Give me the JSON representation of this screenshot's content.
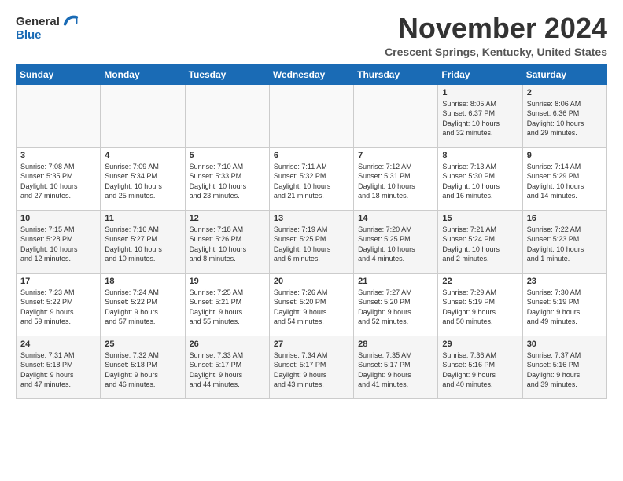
{
  "header": {
    "logo_line1": "General",
    "logo_line2": "Blue",
    "month": "November 2024",
    "location": "Crescent Springs, Kentucky, United States"
  },
  "days_of_week": [
    "Sunday",
    "Monday",
    "Tuesday",
    "Wednesday",
    "Thursday",
    "Friday",
    "Saturday"
  ],
  "weeks": [
    [
      {
        "day": "",
        "info": ""
      },
      {
        "day": "",
        "info": ""
      },
      {
        "day": "",
        "info": ""
      },
      {
        "day": "",
        "info": ""
      },
      {
        "day": "",
        "info": ""
      },
      {
        "day": "1",
        "info": "Sunrise: 8:05 AM\nSunset: 6:37 PM\nDaylight: 10 hours\nand 32 minutes."
      },
      {
        "day": "2",
        "info": "Sunrise: 8:06 AM\nSunset: 6:36 PM\nDaylight: 10 hours\nand 29 minutes."
      }
    ],
    [
      {
        "day": "3",
        "info": "Sunrise: 7:08 AM\nSunset: 5:35 PM\nDaylight: 10 hours\nand 27 minutes."
      },
      {
        "day": "4",
        "info": "Sunrise: 7:09 AM\nSunset: 5:34 PM\nDaylight: 10 hours\nand 25 minutes."
      },
      {
        "day": "5",
        "info": "Sunrise: 7:10 AM\nSunset: 5:33 PM\nDaylight: 10 hours\nand 23 minutes."
      },
      {
        "day": "6",
        "info": "Sunrise: 7:11 AM\nSunset: 5:32 PM\nDaylight: 10 hours\nand 21 minutes."
      },
      {
        "day": "7",
        "info": "Sunrise: 7:12 AM\nSunset: 5:31 PM\nDaylight: 10 hours\nand 18 minutes."
      },
      {
        "day": "8",
        "info": "Sunrise: 7:13 AM\nSunset: 5:30 PM\nDaylight: 10 hours\nand 16 minutes."
      },
      {
        "day": "9",
        "info": "Sunrise: 7:14 AM\nSunset: 5:29 PM\nDaylight: 10 hours\nand 14 minutes."
      }
    ],
    [
      {
        "day": "10",
        "info": "Sunrise: 7:15 AM\nSunset: 5:28 PM\nDaylight: 10 hours\nand 12 minutes."
      },
      {
        "day": "11",
        "info": "Sunrise: 7:16 AM\nSunset: 5:27 PM\nDaylight: 10 hours\nand 10 minutes."
      },
      {
        "day": "12",
        "info": "Sunrise: 7:18 AM\nSunset: 5:26 PM\nDaylight: 10 hours\nand 8 minutes."
      },
      {
        "day": "13",
        "info": "Sunrise: 7:19 AM\nSunset: 5:25 PM\nDaylight: 10 hours\nand 6 minutes."
      },
      {
        "day": "14",
        "info": "Sunrise: 7:20 AM\nSunset: 5:25 PM\nDaylight: 10 hours\nand 4 minutes."
      },
      {
        "day": "15",
        "info": "Sunrise: 7:21 AM\nSunset: 5:24 PM\nDaylight: 10 hours\nand 2 minutes."
      },
      {
        "day": "16",
        "info": "Sunrise: 7:22 AM\nSunset: 5:23 PM\nDaylight: 10 hours\nand 1 minute."
      }
    ],
    [
      {
        "day": "17",
        "info": "Sunrise: 7:23 AM\nSunset: 5:22 PM\nDaylight: 9 hours\nand 59 minutes."
      },
      {
        "day": "18",
        "info": "Sunrise: 7:24 AM\nSunset: 5:22 PM\nDaylight: 9 hours\nand 57 minutes."
      },
      {
        "day": "19",
        "info": "Sunrise: 7:25 AM\nSunset: 5:21 PM\nDaylight: 9 hours\nand 55 minutes."
      },
      {
        "day": "20",
        "info": "Sunrise: 7:26 AM\nSunset: 5:20 PM\nDaylight: 9 hours\nand 54 minutes."
      },
      {
        "day": "21",
        "info": "Sunrise: 7:27 AM\nSunset: 5:20 PM\nDaylight: 9 hours\nand 52 minutes."
      },
      {
        "day": "22",
        "info": "Sunrise: 7:29 AM\nSunset: 5:19 PM\nDaylight: 9 hours\nand 50 minutes."
      },
      {
        "day": "23",
        "info": "Sunrise: 7:30 AM\nSunset: 5:19 PM\nDaylight: 9 hours\nand 49 minutes."
      }
    ],
    [
      {
        "day": "24",
        "info": "Sunrise: 7:31 AM\nSunset: 5:18 PM\nDaylight: 9 hours\nand 47 minutes."
      },
      {
        "day": "25",
        "info": "Sunrise: 7:32 AM\nSunset: 5:18 PM\nDaylight: 9 hours\nand 46 minutes."
      },
      {
        "day": "26",
        "info": "Sunrise: 7:33 AM\nSunset: 5:17 PM\nDaylight: 9 hours\nand 44 minutes."
      },
      {
        "day": "27",
        "info": "Sunrise: 7:34 AM\nSunset: 5:17 PM\nDaylight: 9 hours\nand 43 minutes."
      },
      {
        "day": "28",
        "info": "Sunrise: 7:35 AM\nSunset: 5:17 PM\nDaylight: 9 hours\nand 41 minutes."
      },
      {
        "day": "29",
        "info": "Sunrise: 7:36 AM\nSunset: 5:16 PM\nDaylight: 9 hours\nand 40 minutes."
      },
      {
        "day": "30",
        "info": "Sunrise: 7:37 AM\nSunset: 5:16 PM\nDaylight: 9 hours\nand 39 minutes."
      }
    ]
  ]
}
